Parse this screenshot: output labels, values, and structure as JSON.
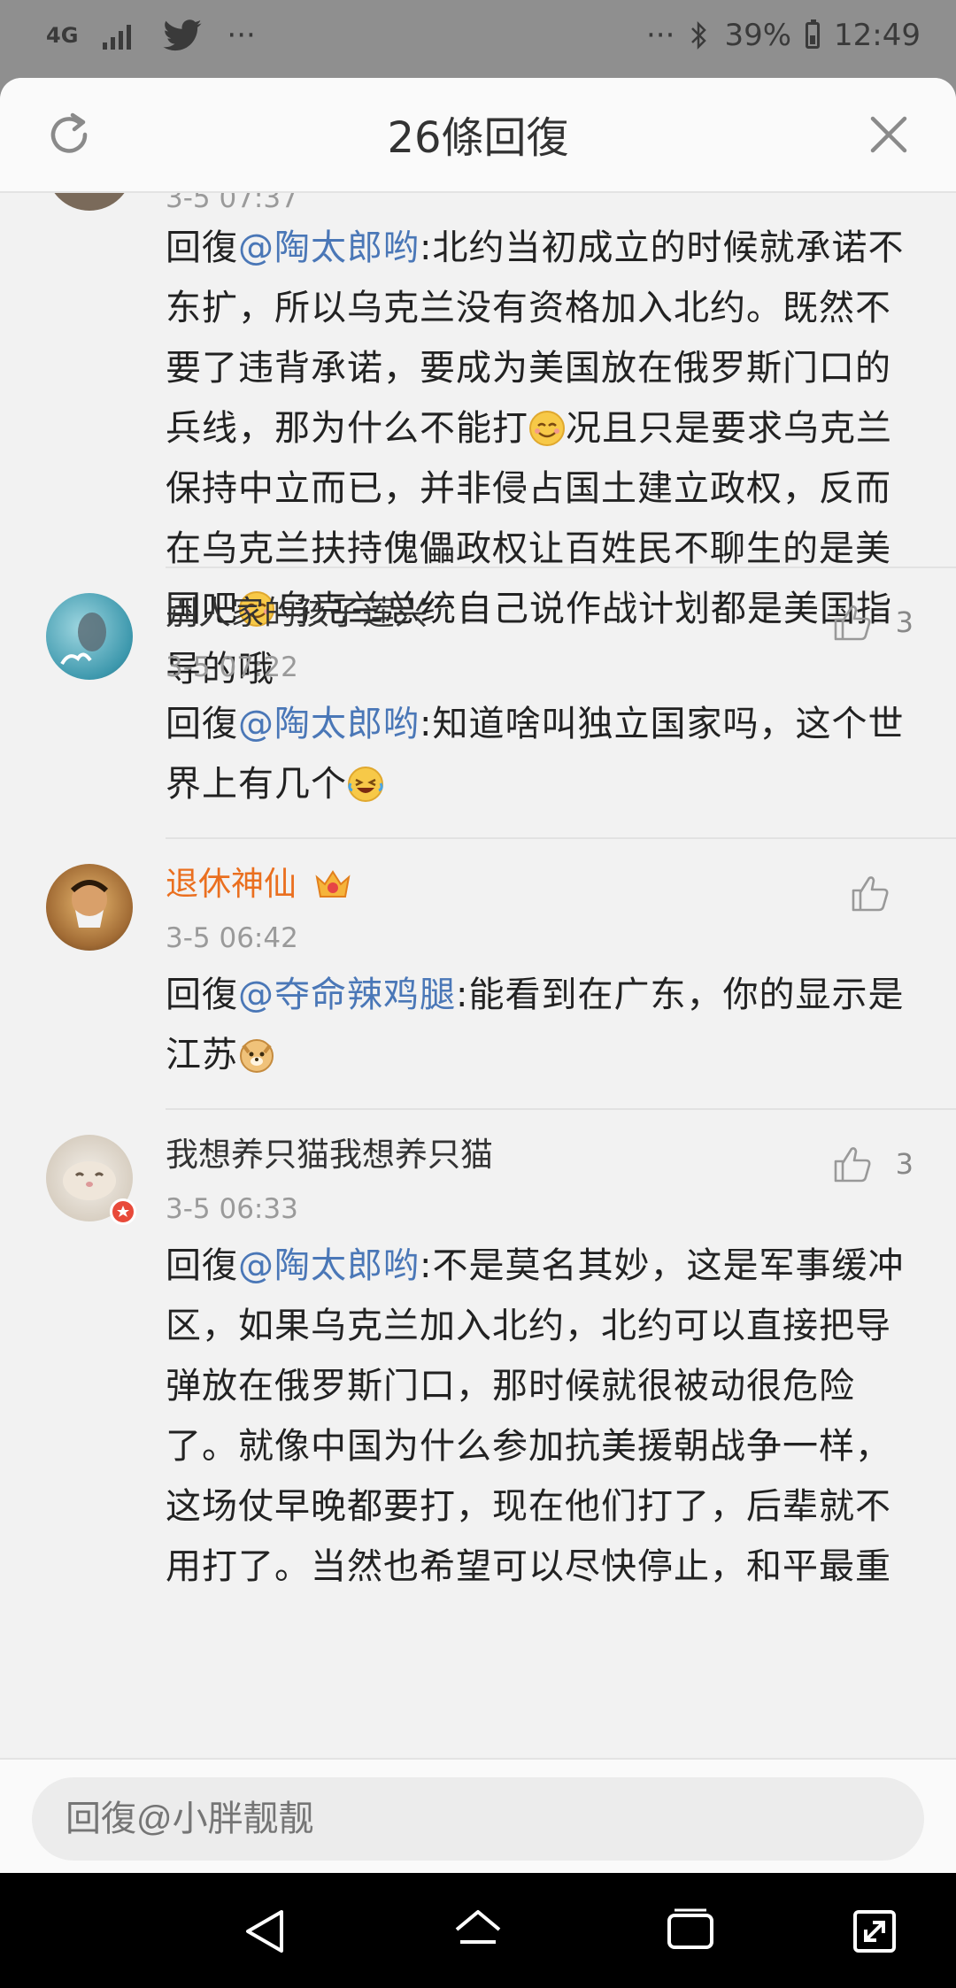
{
  "status_bar": {
    "network": "4G",
    "extra_indicator": "···",
    "right_dots": "···",
    "battery": "39%",
    "time": "12:49"
  },
  "sheet": {
    "title": "26條回復",
    "refresh_icon": "refresh-icon",
    "close_icon": "close-icon"
  },
  "comments": [
    {
      "time": "3-5 07:37",
      "reply_prefix": "回復",
      "mention": "@陶太郎哟",
      "text_1": ":北约当初成立的时候就承诺不东扩，所以乌克兰没有资格加入北约。既然不要了违背承诺，要成为美国放在俄罗斯门口的兵线，那为什么不能打",
      "text_2": "况且只是要求乌克兰保持中立而已，并非侵占国土建立政权，反而在乌克兰扶持傀儡政权让百姓民不聊生的是美国吧",
      "text_3": "乌克兰总统自己说作战计划都是美国指导的哦"
    },
    {
      "username": "别人家的孩子莲兴",
      "time": "3-5 07:22",
      "likes": "3",
      "reply_prefix": "回復",
      "mention": "@陶太郎哟",
      "text_1": ":知道啥叫独立国家吗，这个世界上有几个"
    },
    {
      "username": "退休神仙",
      "time": "3-5 06:42",
      "likes": "",
      "reply_prefix": "回復",
      "mention": "@夺命辣鸡腿",
      "text_1": ":能看到在广东，你的显示是江苏"
    },
    {
      "username": "我想养只猫我想养只猫",
      "time": "3-5 06:33",
      "likes": "3",
      "reply_prefix": "回復",
      "mention": "@陶太郎哟",
      "text_1": ":不是莫名其妙，这是军事缓冲区，如果乌克兰加入北约，北约可以直接把导弹放在俄罗斯门口，那时候就很被动很危险了。就像中国为什么参加抗美援朝战争一样，这场仗早晚都要打，现在他们打了，后辈就不用打了。当然也希望可以尽快停止，和平最重"
    }
  ],
  "reply_bar": {
    "placeholder": "回復@小胖靓靓"
  },
  "colors": {
    "mention": "#4a77b7",
    "vip_name": "#ea6f1f",
    "dim_overlay": "#8f8f8f"
  }
}
